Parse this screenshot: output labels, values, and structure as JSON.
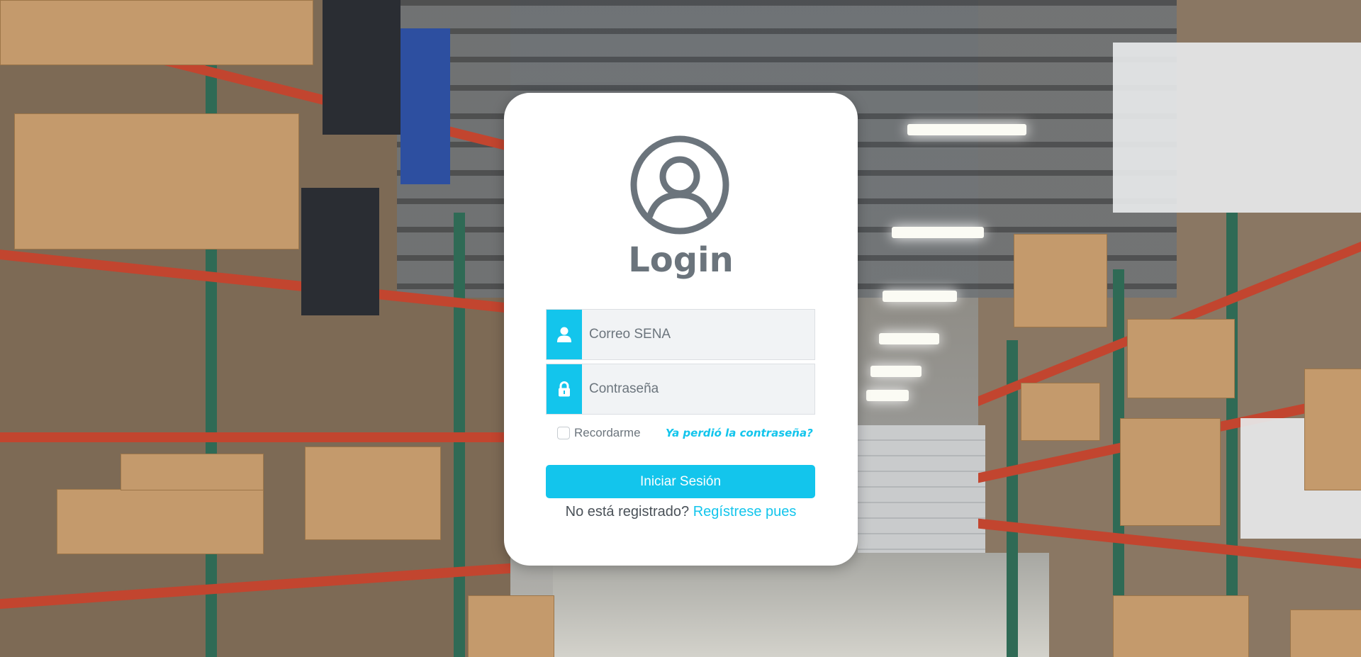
{
  "background": {
    "scene": "warehouse-background-photo"
  },
  "login": {
    "icon": "user-circle-icon",
    "title": "Login",
    "email": {
      "icon": "user-icon",
      "placeholder": "Correo SENA",
      "value": ""
    },
    "password": {
      "icon": "lock-icon",
      "placeholder": "Contraseña",
      "value": ""
    },
    "remember_label": "Recordarme",
    "remember_checked": false,
    "forgot_link": "Ya perdió la contraseña?",
    "submit_label": "Iniciar Sesión",
    "register_prompt": "No está registrado?",
    "register_link": "Regístrese pues"
  },
  "colors": {
    "accent": "#13c5ec",
    "title": "#6b747c",
    "card": "#ffffff"
  }
}
